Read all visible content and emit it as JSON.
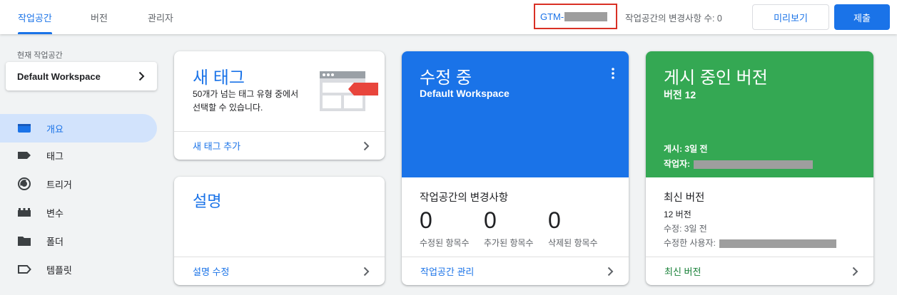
{
  "header": {
    "tabs": [
      {
        "label": "작업공간",
        "active": true
      },
      {
        "label": "버전",
        "active": false
      },
      {
        "label": "관리자",
        "active": false
      }
    ],
    "container_id_prefix": "GTM-",
    "workspace_changes_label": "작업공간의 변경사항 수: 0",
    "preview_label": "미리보기",
    "submit_label": "제출"
  },
  "sidebar": {
    "current_workspace_label": "현재 작업공간",
    "workspace_name": "Default Workspace",
    "items": [
      {
        "label": "개요",
        "icon": "overview-icon",
        "active": true
      },
      {
        "label": "태그",
        "icon": "tag-icon",
        "active": false
      },
      {
        "label": "트리거",
        "icon": "trigger-icon",
        "active": false
      },
      {
        "label": "변수",
        "icon": "variable-icon",
        "active": false
      },
      {
        "label": "폴더",
        "icon": "folder-icon",
        "active": false
      },
      {
        "label": "템플릿",
        "icon": "template-icon",
        "active": false
      }
    ]
  },
  "cards": {
    "new_tag": {
      "title": "새 태그",
      "description": "50개가 넘는 태그 유형 중에서 선택할 수 있습니다.",
      "footer": "새 태그 추가"
    },
    "description": {
      "title": "설명",
      "footer": "설명 수정"
    },
    "editing": {
      "title": "수정 중",
      "workspace": "Default Workspace",
      "changes_title": "작업공간의 변경사항",
      "stats": [
        {
          "value": "0",
          "label": "수정된 항목수"
        },
        {
          "value": "0",
          "label": "추가된 항목수"
        },
        {
          "value": "0",
          "label": "삭제된 항목수"
        }
      ],
      "footer": "작업공간 관리"
    },
    "published": {
      "title": "게시 중인 버전",
      "version": "버전 12",
      "published_ago": "게시: 3일 전",
      "author_label": "작업자:",
      "latest_title": "최신 버전",
      "latest_version": "12 버전",
      "latest_modified": "수정: 3일 전",
      "latest_modified_by": "수정한 사용자:",
      "footer": "최신 버전"
    }
  },
  "colors": {
    "accent": "#1a73e8",
    "published": "#34a853",
    "highlight_box": "#d93025"
  }
}
